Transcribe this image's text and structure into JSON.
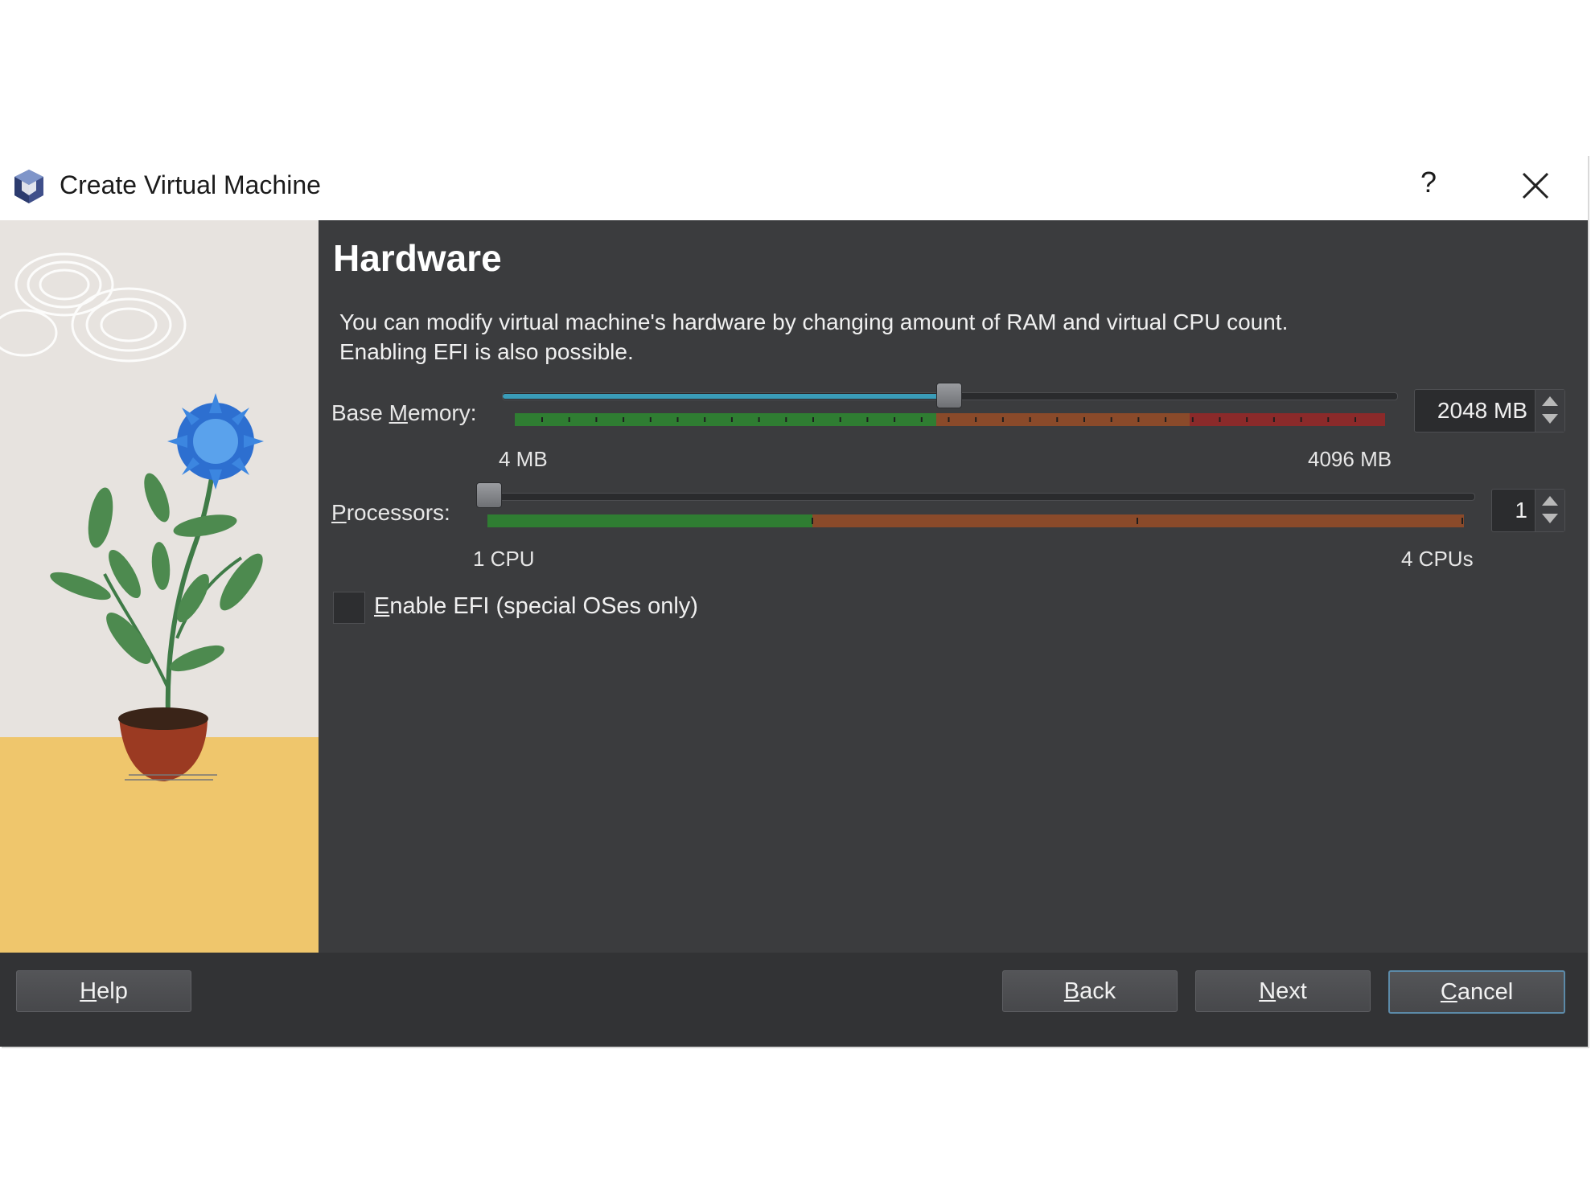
{
  "window": {
    "title": "Create Virtual Machine",
    "help_glyph": "?",
    "close_icon": "close-icon"
  },
  "page": {
    "heading": "Hardware",
    "description_line1": "You can modify virtual machine's hardware by changing amount of RAM and virtual CPU count.",
    "description_line2": "Enabling EFI is also possible."
  },
  "memory": {
    "label_pre": "Base ",
    "label_mnemonic": "M",
    "label_post": "emory:",
    "min_label": "4 MB",
    "max_label": "4096 MB",
    "value": "2048 MB",
    "position_fraction": 0.5
  },
  "processors": {
    "label_mnemonic": "P",
    "label_post": "rocessors:",
    "min_label": "1 CPU",
    "max_label": "4 CPUs",
    "value": "1",
    "position_fraction": 0.0
  },
  "efi": {
    "label_mnemonic": "E",
    "label_post": "nable EFI (special OSes only)",
    "checked": false
  },
  "buttons": {
    "help": {
      "mnemonic": "H",
      "rest": "elp"
    },
    "back": {
      "mnemonic": "B",
      "rest": "ack"
    },
    "next": {
      "mnemonic": "N",
      "rest": "ext"
    },
    "cancel": {
      "mnemonic": "C",
      "rest": "ancel"
    }
  },
  "colors": {
    "zone_green": "#2f7d32",
    "zone_orange": "#8a4a2a",
    "zone_red": "#8b2a2a",
    "accent": "#3a9cb8"
  }
}
